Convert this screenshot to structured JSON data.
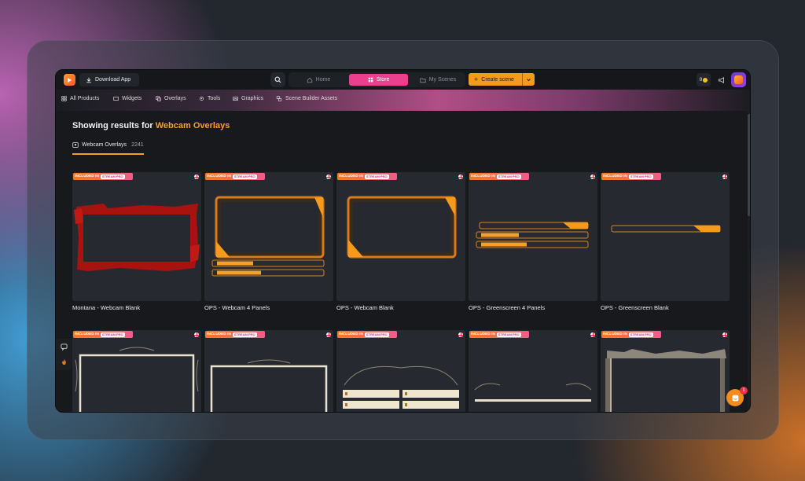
{
  "topbar": {
    "download_label": "Download App",
    "nav": {
      "home": "Home",
      "store": "Store",
      "my_scenes": "My Scenes"
    },
    "create_label": "Create scene",
    "coins": "0"
  },
  "categories": [
    "All Products",
    "Widgets",
    "Overlays",
    "Tools",
    "Graphics",
    "Scene Builder Assets"
  ],
  "results": {
    "prefix": "Showing results for",
    "query": "Webcam Overlays"
  },
  "tab": {
    "label": "Webcam Overlays",
    "count": "2241"
  },
  "badge": {
    "included_in": "INCLUDED IN",
    "brand": "STREAM",
    "pro": "PRO"
  },
  "cards_row1": [
    {
      "title": "Montana - Webcam Blank"
    },
    {
      "title": "OPS - Webcam 4 Panels"
    },
    {
      "title": "OPS - Webcam Blank"
    },
    {
      "title": "OPS - Greenscreen 4 Panels"
    },
    {
      "title": "OPS - Greenscreen Blank"
    }
  ],
  "chat": {
    "unread": "1"
  },
  "colors": {
    "accent": "#f5a02a",
    "store_active": "#ee3f8f",
    "create": "#f59a1b"
  }
}
